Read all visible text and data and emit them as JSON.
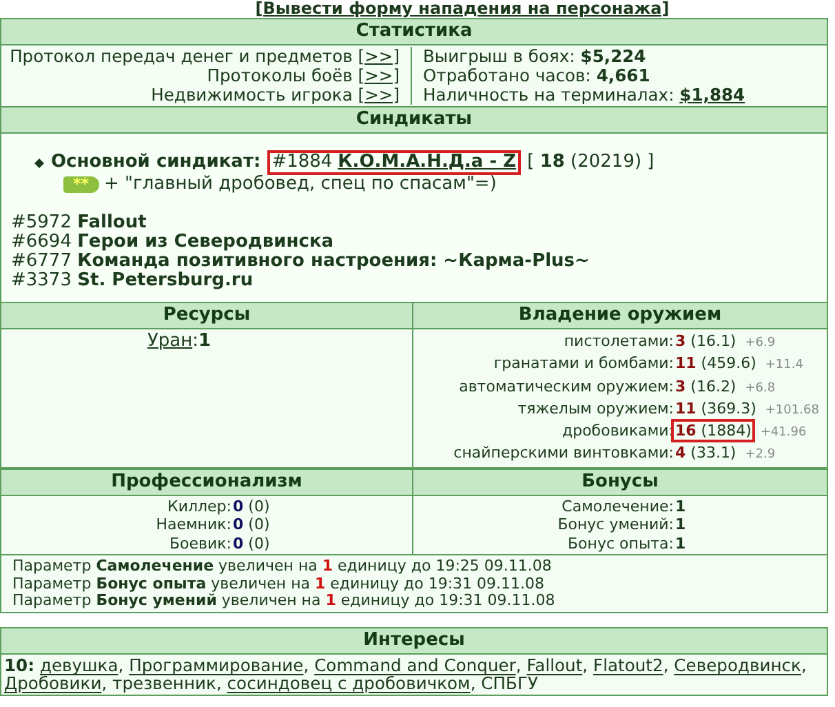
{
  "top_link": "[Вывести форму нападения на персонажа]",
  "statistics": {
    "title": "Статистика",
    "protocols": [
      {
        "label": "Протокол передач денег и предметов",
        "link": "[>>]"
      },
      {
        "label": "Протоколы боёв",
        "link": "[>>]"
      },
      {
        "label": "Недвижимость игрока",
        "link": "[>>]"
      }
    ],
    "totals": [
      {
        "label": "Выигрыш в боях:",
        "value": "$5,224",
        "link": false
      },
      {
        "label": "Отработано часов:",
        "value": "4,661",
        "link": false
      },
      {
        "label": "Наличность на терминалах:",
        "value": "$1,884",
        "link": true
      }
    ]
  },
  "syndicates": {
    "title": "Синдикаты",
    "main": {
      "label": "Основной синдикат:",
      "number": "#1884",
      "name": "К.О.М.А.Н.Д.а - Z",
      "open": "[",
      "level": "18",
      "points": "(20219)",
      "close": "]",
      "badge": "**",
      "motto": "+ \"главный дробовед, спец по спасам\"=)",
      "highlighted": true
    },
    "others": [
      {
        "number": "#5972",
        "name": "Fallout"
      },
      {
        "number": "#6694",
        "name": "Герои из Северодвинска"
      },
      {
        "number": "#6777",
        "name": "Команда позитивного настроения: ~Карма-Plus~"
      },
      {
        "number": "#3373",
        "name": "St. Petersburg.ru"
      }
    ]
  },
  "resources": {
    "title": "Ресурсы",
    "items": [
      {
        "name": "Уран",
        "sep": ":",
        "value": "1"
      }
    ]
  },
  "weapons": {
    "title": "Владение оружием",
    "rows": [
      {
        "label": "пистолетами:",
        "level": "3",
        "experience": "(16.1)",
        "gain": "+6.9",
        "highlighted": false
      },
      {
        "label": "гранатами и бомбами:",
        "level": "11",
        "experience": "(459.6)",
        "gain": "+11.4",
        "highlighted": false
      },
      {
        "label": "автоматическим оружием:",
        "level": "3",
        "experience": "(16.2)",
        "gain": "+6.8",
        "highlighted": false
      },
      {
        "label": "тяжелым оружием:",
        "level": "11",
        "experience": "(369.3)",
        "gain": "+101.68",
        "highlighted": false
      },
      {
        "label": "дробовиками:",
        "level": "16",
        "experience": "(1884)",
        "gain": "+41.96",
        "highlighted": true
      },
      {
        "label": "снайперскими винтовками:",
        "level": "4",
        "experience": "(33.1)",
        "gain": "+2.9",
        "highlighted": false
      }
    ]
  },
  "professionalism": {
    "title": "Профессионализм",
    "rows": [
      {
        "label": "Киллер:",
        "value": "0",
        "extra": "(0)"
      },
      {
        "label": "Наемник:",
        "value": "0",
        "extra": "(0)"
      },
      {
        "label": "Боевик:",
        "value": "0",
        "extra": "(0)"
      }
    ]
  },
  "bonuses": {
    "title": "Бонусы",
    "rows": [
      {
        "label": "Самолечение:",
        "value": "1"
      },
      {
        "label": "Бонус умений:",
        "value": "1"
      },
      {
        "label": "Бонус опыта:",
        "value": "1"
      }
    ]
  },
  "notes": [
    {
      "prefix": "Параметр",
      "param": "Самолечение",
      "mid": "увеличен на",
      "amount": "1",
      "suffix": "единицу до 19:25 09.11.08"
    },
    {
      "prefix": "Параметр",
      "param": "Бонус опыта",
      "mid": "увеличен на",
      "amount": "1",
      "suffix": "единицу до 19:31 09.11.08"
    },
    {
      "prefix": "Параметр",
      "param": "Бонус умений",
      "mid": "увеличен на",
      "amount": "1",
      "suffix": "единицу до 19:31 09.11.08"
    }
  ],
  "interests": {
    "title": "Интересы",
    "count": "10:",
    "items": [
      {
        "text": "девушка",
        "link": true,
        "sep": ","
      },
      {
        "text": "Программирование",
        "link": true,
        "sep": ","
      },
      {
        "text": "Command and Conquer",
        "link": true,
        "sep": ","
      },
      {
        "text": "Fallout",
        "link": true,
        "sep": ","
      },
      {
        "text": "Flatout2",
        "link": true,
        "sep": ","
      },
      {
        "text": "Северодвинск",
        "link": true,
        "sep": ","
      },
      {
        "text": "Дробовики",
        "link": true,
        "sep": ","
      },
      {
        "text": "трезвенник",
        "link": false,
        "sep": ","
      },
      {
        "text": "сосиндовец с дробовичком",
        "link": true,
        "sep": ","
      },
      {
        "text": "СПБГУ",
        "link": false
      }
    ]
  }
}
